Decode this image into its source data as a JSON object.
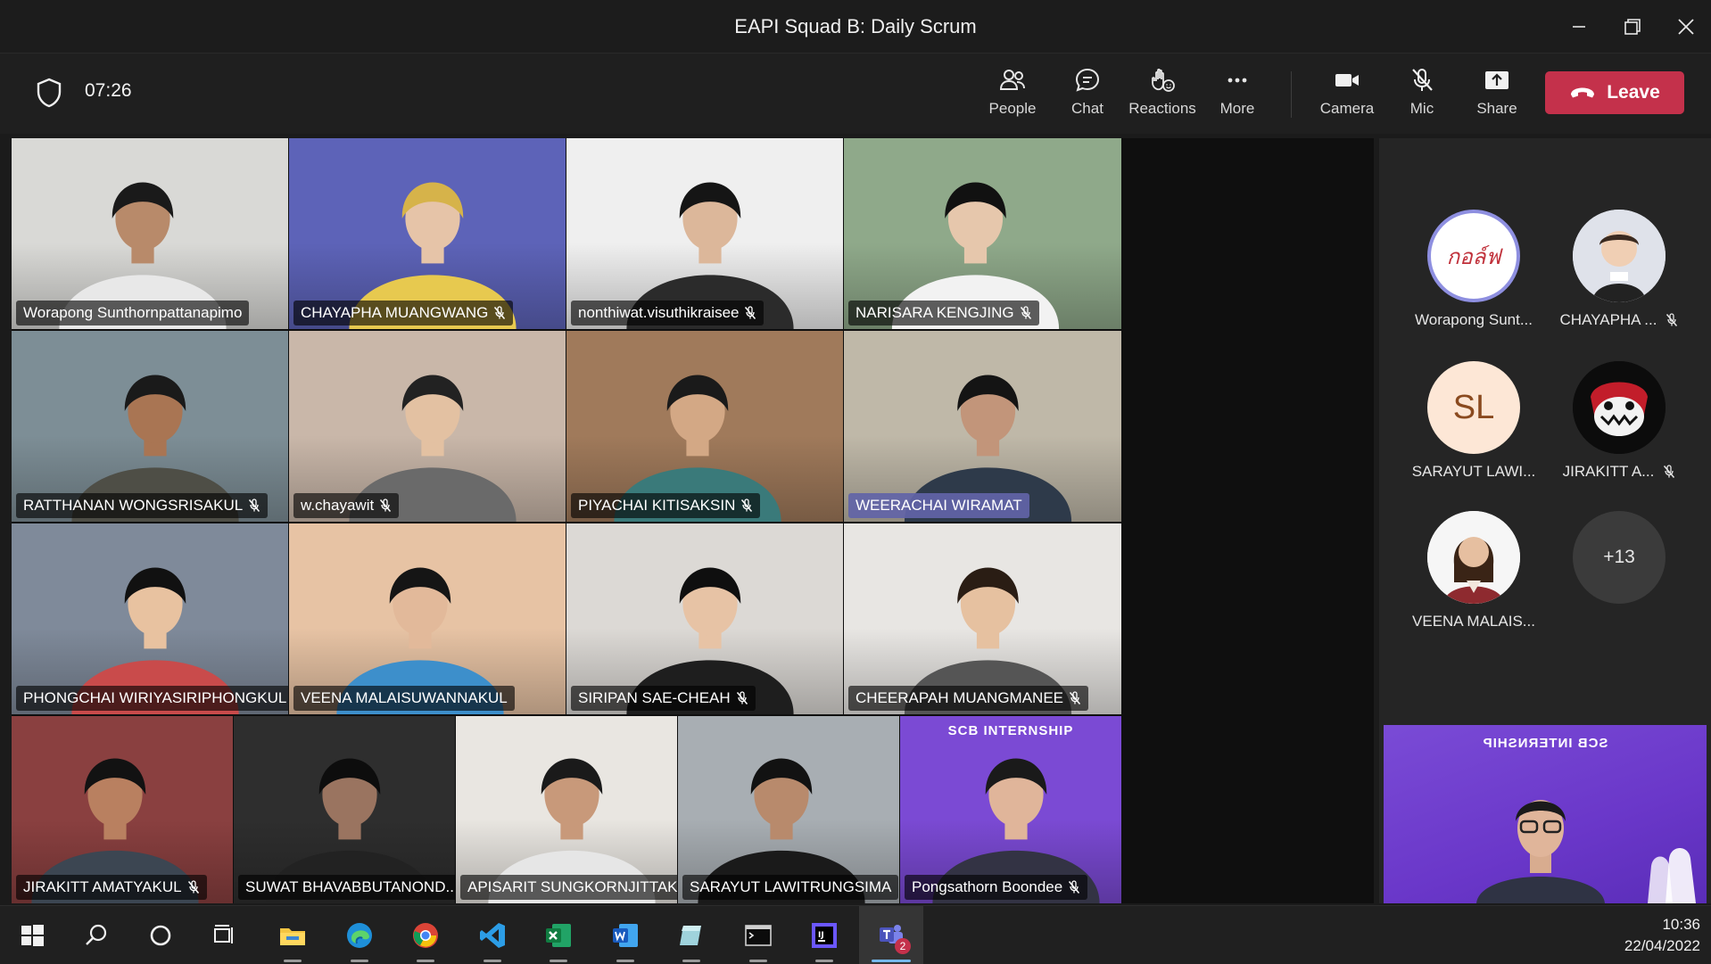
{
  "window": {
    "title": "EAPI Squad B: Daily Scrum",
    "controls": [
      "minimize",
      "maximize",
      "close"
    ]
  },
  "toolbar": {
    "timer": "07:26",
    "buttons": [
      {
        "label": "People",
        "icon": "people-icon"
      },
      {
        "label": "Chat",
        "icon": "chat-icon"
      },
      {
        "label": "Reactions",
        "icon": "reactions-icon"
      },
      {
        "label": "More",
        "icon": "more-icon"
      },
      {
        "label": "Camera",
        "icon": "camera-icon"
      },
      {
        "label": "Mic",
        "icon": "mic-off-icon"
      },
      {
        "label": "Share",
        "icon": "share-icon"
      }
    ],
    "leave_label": "Leave",
    "leave_color": "#c4314b"
  },
  "grid": {
    "tiles": [
      {
        "name": "Worapong Sunthornpattanapimo",
        "muted": false,
        "bg": "#d9d9d6",
        "skin": "#b88a6a",
        "shirt": "#e8e8e8",
        "hair": "#1a1a1a"
      },
      {
        "name": "CHAYAPHA MUANGWANG",
        "muted": true,
        "bg": "#5d63b8",
        "skin": "#e6c4a8",
        "shirt": "#e7c94f",
        "hair": "#d6b34a"
      },
      {
        "name": "nonthiwat.visuthikraisee",
        "muted": true,
        "bg": "#efefef",
        "skin": "#dcb79a",
        "shirt": "#2b2b2b",
        "hair": "#151515"
      },
      {
        "name": "NARISARA KENGJING",
        "muted": true,
        "bg": "#8fa98a",
        "skin": "#e6c7ac",
        "shirt": "#f2f2f2",
        "hair": "#111111"
      },
      {
        "name": "RATTHANAN WONGSRISAKUL",
        "muted": true,
        "bg": "#7d8e96",
        "skin": "#a97553",
        "shirt": "#4e4e46",
        "hair": "#1a1a1a"
      },
      {
        "name": "w.chayawit",
        "muted": true,
        "bg": "#c9b7a9",
        "skin": "#e3c1a2",
        "shirt": "#6a6a6a",
        "hair": "#222222"
      },
      {
        "name": "PIYACHAI KITISAKSIN",
        "muted": true,
        "bg": "#a07a5b",
        "skin": "#d3a885",
        "shirt": "#3a7a7a",
        "hair": "#1a1a1a"
      },
      {
        "name": "WEERACHAI WIRAMAT",
        "muted": false,
        "bg": "#bfb8a8",
        "skin": "#c2957a",
        "shirt": "#2e3a4a",
        "hair": "#141414"
      },
      {
        "name": "PHONGCHAI WIRIYASIRIPHONGKUL",
        "muted": true,
        "bg": "#7f8a9a",
        "skin": "#e8c2a0",
        "shirt": "#c94b4b",
        "hair": "#111111"
      },
      {
        "name": "VEENA MALAISUWANNAKUL",
        "muted": false,
        "bg": "#e7c3a4",
        "skin": "#e2b99a",
        "shirt": "#3d8fcb",
        "hair": "#151515"
      },
      {
        "name": "SIRIPAN SAE-CHEAH",
        "muted": true,
        "bg": "#dcd9d5",
        "skin": "#e7c3a5",
        "shirt": "#1e1e1e",
        "hair": "#0f0f0f"
      },
      {
        "name": "CHEERAPAH MUANGMANEE",
        "muted": true,
        "bg": "#e8e6e3",
        "skin": "#e6c1a0",
        "shirt": "#555555",
        "hair": "#2a1d14"
      },
      {
        "name": "JIRAKITT AMATYAKUL",
        "muted": true,
        "bg": "#8a4040",
        "skin": "#b98060",
        "shirt": "#3c4652",
        "hair": "#121212"
      },
      {
        "name": "SUWAT BHAVABBUTANOND...",
        "muted": true,
        "bg": "#2e2e2e",
        "skin": "#9a7460",
        "shirt": "#222222",
        "hair": "#0d0d0d"
      },
      {
        "name": "APISARIT SUNGKORNJITTAK...",
        "muted": true,
        "bg": "#e9e6e1",
        "skin": "#c8997a",
        "shirt": "#e6e6e6",
        "hair": "#1a1a1a"
      },
      {
        "name": "SARAYUT LAWITRUNGSIMA",
        "muted": false,
        "bg": "#a8aeb3",
        "skin": "#b88a6c",
        "shirt": "#1a1a1a",
        "hair": "#121212"
      },
      {
        "name": "Pongsathorn Boondee",
        "muted": true,
        "bg": "#7b4ad4",
        "skin": "#e0b59a",
        "shirt": "#334",
        "hair": "#1a1a1a",
        "banner": "SCB INTERNSHIP"
      }
    ]
  },
  "panel": {
    "participants": [
      {
        "name": "Worapong Sunt...",
        "muted": false,
        "kind": "logo",
        "logo_text": "กอล์ฟ"
      },
      {
        "name": "CHAYAPHA ...",
        "muted": true,
        "kind": "photo",
        "bg": "#d6d9e4"
      },
      {
        "name": "SARAYUT LAWI...",
        "muted": false,
        "kind": "initials",
        "initials": "SL",
        "bg": "#fde7d6",
        "fg": "#8a4a1f"
      },
      {
        "name": "JIRAKITT A...",
        "muted": true,
        "kind": "photo",
        "bg": "#111111"
      },
      {
        "name": "VEENA MALAIS...",
        "muted": false,
        "kind": "photo",
        "bg": "#f4f4f4"
      }
    ],
    "overflow": "+13",
    "self_view_banner": "SCB INTERNSHIP"
  },
  "taskbar": {
    "apps": [
      {
        "icon": "windows-start-icon"
      },
      {
        "icon": "search-icon"
      },
      {
        "icon": "cortana-icon"
      },
      {
        "icon": "task-view-icon"
      },
      {
        "icon": "file-explorer-icon"
      },
      {
        "icon": "edge-icon"
      },
      {
        "icon": "chrome-icon"
      },
      {
        "icon": "vscode-icon"
      },
      {
        "icon": "excel-icon"
      },
      {
        "icon": "word-icon"
      },
      {
        "icon": "azure-data-studio-icon"
      },
      {
        "icon": "terminal-icon"
      },
      {
        "icon": "intellij-icon"
      },
      {
        "icon": "teams-icon",
        "badge": "2"
      }
    ],
    "time": "10:36",
    "date": "22/04/2022"
  }
}
